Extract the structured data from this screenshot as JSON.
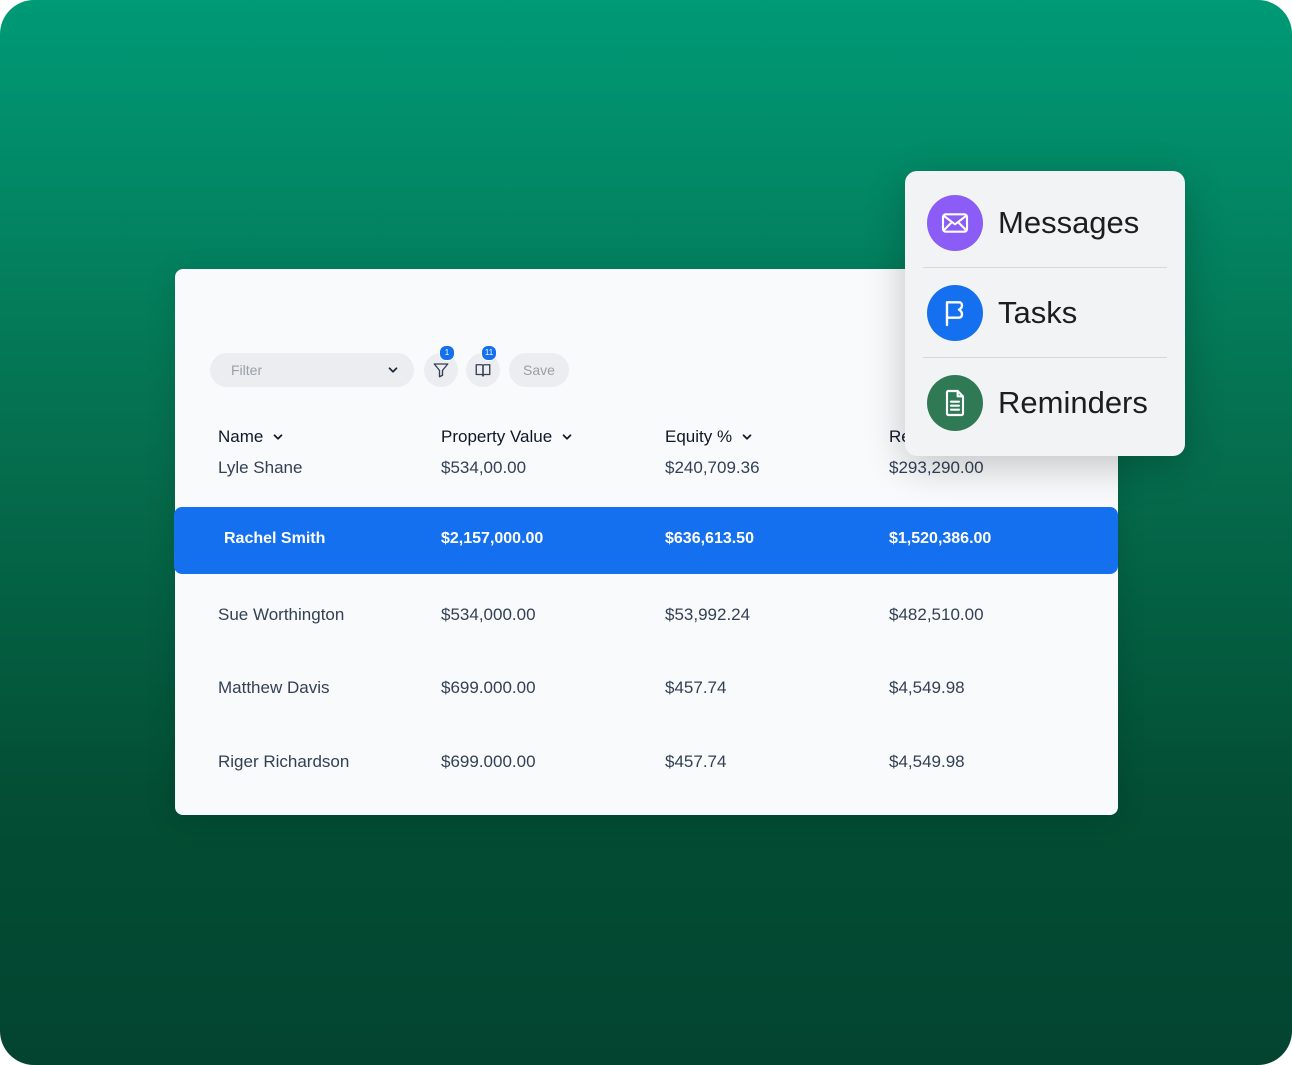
{
  "toolbar": {
    "filter_placeholder": "Filter",
    "filter_badge": "1",
    "columns_badge": "11",
    "save_label": "Save"
  },
  "table": {
    "columns": [
      "Name",
      "Property Value",
      "Equity %",
      "Re"
    ],
    "rows": [
      {
        "name": "Lyle Shane",
        "property_value": "$534,00.00",
        "equity": "$240,709.36",
        "re": "$293,290.00"
      },
      {
        "name": "Rachel Smith",
        "property_value": "$2,157,000.00",
        "equity": "$636,613.50",
        "re": "$1,520,386.00"
      },
      {
        "name": "Sue Worthington",
        "property_value": "$534,000.00",
        "equity": "$53,992.24",
        "re": "$482,510.00"
      },
      {
        "name": "Matthew Davis",
        "property_value": "$699.000.00",
        "equity": "$457.74",
        "re": "$4,549.98"
      },
      {
        "name": "Riger Richardson",
        "property_value": "$699.000.00",
        "equity": "$457.74",
        "re": "$4,549.98"
      }
    ],
    "selected_row_index": 1
  },
  "menu": {
    "items": [
      {
        "label": "Messages",
        "icon": "envelope-icon",
        "color": "#8b5cf6"
      },
      {
        "label": "Tasks",
        "icon": "flag-icon",
        "color": "#1570ef"
      },
      {
        "label": "Reminders",
        "icon": "document-icon",
        "color": "#2f7a55"
      }
    ]
  },
  "colors": {
    "accent": "#1570ef",
    "background_top": "#009a76",
    "background_bottom": "#034430"
  }
}
